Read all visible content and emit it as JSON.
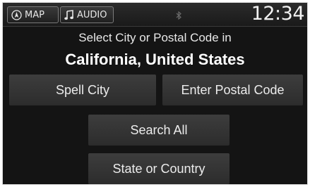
{
  "header": {
    "map_tab_label": "MAP",
    "audio_tab_label": "AUDIO",
    "bluetooth_symbol": "ʙ",
    "clock": "12:34"
  },
  "main": {
    "prompt": "Select City or Postal Code in",
    "region": "California, United States"
  },
  "buttons": {
    "spell_city": "Spell City",
    "enter_postal_code": "Enter Postal Code",
    "search_all": "Search All",
    "state_or_country": "State or Country"
  },
  "icons": {
    "map": "compass-arrow-icon",
    "audio": "music-note-icon",
    "bluetooth": "bluetooth-icon"
  },
  "colors": {
    "background": "#141414",
    "button": "#353535",
    "text": "#ececec"
  }
}
